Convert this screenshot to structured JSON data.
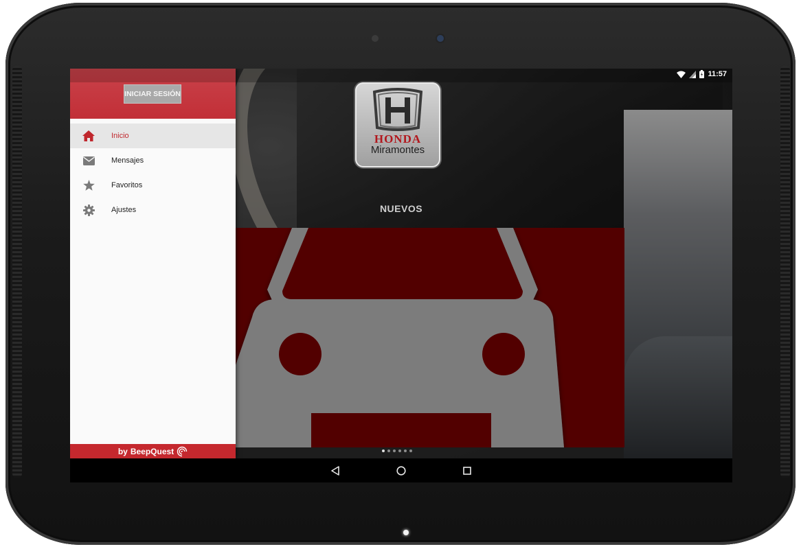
{
  "status_bar": {
    "time": "11:57",
    "icons": [
      "wifi-icon",
      "signal-icon",
      "battery-icon"
    ]
  },
  "drawer": {
    "login_label": "INICIAR SESIÓN",
    "items": [
      {
        "label": "Inicio",
        "icon": "home-icon",
        "active": true
      },
      {
        "label": "Mensajes",
        "icon": "envelope-icon",
        "active": false
      },
      {
        "label": "Favoritos",
        "icon": "star-icon",
        "active": false
      },
      {
        "label": "Ajustes",
        "icon": "gear-icon",
        "active": false
      }
    ],
    "footer_by": "by",
    "footer_brand": "BeepQuest"
  },
  "main": {
    "logo_brand": "HONDA",
    "logo_dealer": "Miramontes",
    "section_title": "NUEVOS",
    "card_icon": "car-icon"
  },
  "colors": {
    "accent": "#c5282e",
    "active_item": "#c0272d",
    "card_bg": "#520000",
    "card_icon": "#7b7b7b"
  },
  "navbar": {
    "buttons": [
      "back-icon",
      "home-circle-icon",
      "recents-icon"
    ]
  }
}
